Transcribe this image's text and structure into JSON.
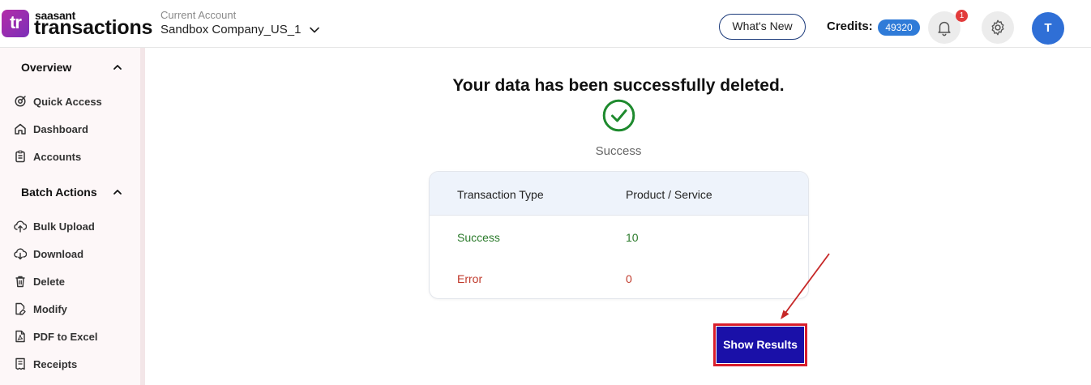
{
  "header": {
    "logo_small": "saasant",
    "logo_big": "transactions",
    "logo_mark": "tr",
    "account_label": "Current Account",
    "account_name": "Sandbox Company_US_1",
    "whats_new": "What's New",
    "credits_label": "Credits:",
    "credits_value": "49320",
    "notification_count": "1",
    "avatar_initial": "T"
  },
  "sidebar": {
    "sections": [
      {
        "title": "Overview",
        "items": [
          {
            "label": "Quick Access",
            "icon": "quick-access-icon"
          },
          {
            "label": "Dashboard",
            "icon": "home-icon"
          },
          {
            "label": "Accounts",
            "icon": "clipboard-icon"
          }
        ]
      },
      {
        "title": "Batch Actions",
        "items": [
          {
            "label": "Bulk Upload",
            "icon": "cloud-upload-icon"
          },
          {
            "label": "Download",
            "icon": "cloud-download-icon"
          },
          {
            "label": "Delete",
            "icon": "trash-icon"
          },
          {
            "label": "Modify",
            "icon": "edit-file-icon"
          },
          {
            "label": "PDF to Excel",
            "icon": "pdf-icon"
          },
          {
            "label": "Receipts",
            "icon": "receipt-icon"
          }
        ]
      }
    ]
  },
  "main": {
    "title": "Your data has been successfully deleted.",
    "status": "Success",
    "table": {
      "headers": [
        "Transaction Type",
        "Product / Service"
      ],
      "rows": [
        [
          "Success",
          "10"
        ],
        [
          "Error",
          "0"
        ]
      ]
    },
    "show_results_label": "Show Results"
  },
  "colors": {
    "accent": "#1a10a8",
    "success": "#2a7a2a",
    "error": "#c0392b",
    "highlight": "#d81e2c",
    "credits_badge": "#2f7bd8"
  }
}
